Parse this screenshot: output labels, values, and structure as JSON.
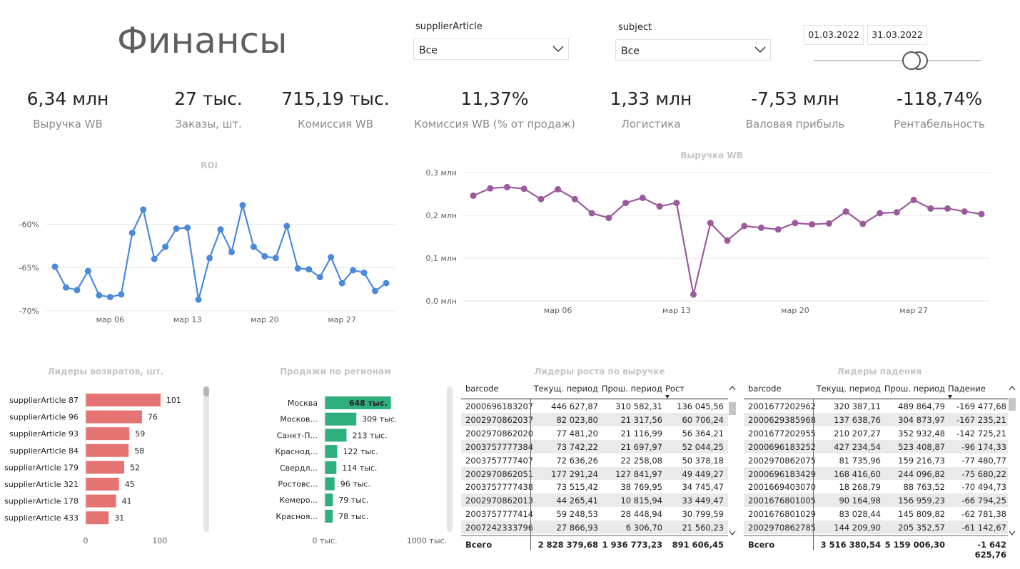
{
  "page_title": "Финансы",
  "filters": {
    "supplier_article": {
      "label": "supplierArticle",
      "value": "Все"
    },
    "subject": {
      "label": "subject",
      "value": "Все"
    },
    "date_from": "01.03.2022",
    "date_to": "31.03.2022"
  },
  "kpis": [
    {
      "value": "6,34 млн",
      "label": "Выручка WB"
    },
    {
      "value": "27 тыс.",
      "label": "Заказы, шт."
    },
    {
      "value": "715,19 тыс.",
      "label": "Комиссия WB"
    },
    {
      "value": "11,37%",
      "label": "Комиссия WB (% от продаж)"
    },
    {
      "value": "1,33 млн",
      "label": "Логистика"
    },
    {
      "value": "-7,53 млн",
      "label": "Валовая прибыль"
    },
    {
      "value": "-118,74%",
      "label": "Рентабельность"
    }
  ],
  "chart_data": [
    {
      "type": "line",
      "title": "ROI",
      "color": "#4a89dc",
      "x": [
        "2022-03-01",
        "2022-03-02",
        "2022-03-03",
        "2022-03-04",
        "2022-03-05",
        "2022-03-06",
        "2022-03-07",
        "2022-03-08",
        "2022-03-09",
        "2022-03-10",
        "2022-03-11",
        "2022-03-12",
        "2022-03-13",
        "2022-03-14",
        "2022-03-15",
        "2022-03-16",
        "2022-03-17",
        "2022-03-18",
        "2022-03-19",
        "2022-03-20",
        "2022-03-21",
        "2022-03-22",
        "2022-03-23",
        "2022-03-24",
        "2022-03-25",
        "2022-03-26",
        "2022-03-27",
        "2022-03-28",
        "2022-03-29",
        "2022-03-30",
        "2022-03-31"
      ],
      "values": [
        -64.9,
        -67.3,
        -67.6,
        -65.4,
        -68.2,
        -68.4,
        -68.1,
        -61.0,
        -58.3,
        -64.0,
        -62.6,
        -60.5,
        -60.4,
        -68.7,
        -63.9,
        -60.6,
        -63.2,
        -57.8,
        -62.6,
        -63.7,
        -63.9,
        -60.2,
        -65.1,
        -65.2,
        -66.1,
        -63.8,
        -66.8,
        -65.3,
        -65.6,
        -67.7,
        -66.8
      ],
      "xticks": [
        "мар 06",
        "мар 13",
        "мар 20",
        "мар 27"
      ],
      "yticks": [
        "-60%",
        "-65%",
        "-70%"
      ],
      "ylim": [
        -70,
        -56.5
      ]
    },
    {
      "type": "line",
      "title": "Выручка WB",
      "color": "#9b5a9b",
      "x": [
        "2022-03-01",
        "2022-03-02",
        "2022-03-03",
        "2022-03-04",
        "2022-03-05",
        "2022-03-06",
        "2022-03-07",
        "2022-03-08",
        "2022-03-09",
        "2022-03-10",
        "2022-03-11",
        "2022-03-12",
        "2022-03-13",
        "2022-03-14",
        "2022-03-15",
        "2022-03-16",
        "2022-03-17",
        "2022-03-18",
        "2022-03-19",
        "2022-03-20",
        "2022-03-21",
        "2022-03-22",
        "2022-03-23",
        "2022-03-24",
        "2022-03-25",
        "2022-03-26",
        "2022-03-27",
        "2022-03-28",
        "2022-03-29",
        "2022-03-30",
        "2022-03-31"
      ],
      "values": [
        0.246,
        0.263,
        0.266,
        0.262,
        0.238,
        0.261,
        0.238,
        0.205,
        0.194,
        0.229,
        0.241,
        0.221,
        0.229,
        0.015,
        0.182,
        0.141,
        0.175,
        0.171,
        0.167,
        0.182,
        0.179,
        0.181,
        0.209,
        0.18,
        0.205,
        0.207,
        0.236,
        0.216,
        0.216,
        0.209,
        0.203
      ],
      "xticks": [
        "мар 06",
        "мар 13",
        "мар 20",
        "мар 27"
      ],
      "yticks": [
        "0,3 млн",
        "0,2 млн",
        "0,1 млн",
        "0,0 млн"
      ],
      "ylim": [
        0,
        0.3
      ]
    },
    {
      "type": "bar",
      "title": "Лидеры возвратов, шт.",
      "color": "#e57373",
      "categories": [
        "supplierArticle 87",
        "supplierArticle 96",
        "supplierArticle 93",
        "supplierArticle 84",
        "supplierArticle 179",
        "supplierArticle 321",
        "supplierArticle 178",
        "supplierArticle 433"
      ],
      "values": [
        101,
        76,
        59,
        58,
        52,
        45,
        41,
        31
      ],
      "xticks": [
        "0",
        "100"
      ],
      "xlim": [
        0,
        104
      ]
    },
    {
      "type": "bar",
      "title": "Продажи по регионам",
      "color": "#2fae7e",
      "categories": [
        "Москва",
        "Москов...",
        "Санкт-П...",
        "Краснод...",
        "Свердл...",
        "Ростовс...",
        "Кемеро...",
        "Красноя..."
      ],
      "values": [
        648,
        309,
        213,
        122,
        114,
        96,
        79,
        78
      ],
      "labels": [
        "648 тыс.",
        "309 тыс.",
        "213 тыс.",
        "122 тыс.",
        "114 тыс.",
        "96 тыс.",
        "79 тыс.",
        "78 тыс."
      ],
      "xticks": [
        "0 тыс.",
        "1000 тыс."
      ],
      "xlim": [
        0,
        1000
      ]
    }
  ],
  "growth_table": {
    "title": "Лидеры роста по выручке",
    "columns": [
      "barcode",
      "Текущ. период",
      "Прош. период",
      "Рост"
    ],
    "rows": [
      [
        "2000696183207",
        "446 627,87",
        "310 582,31",
        "136 045,56"
      ],
      [
        "2002970862037",
        "82 023,80",
        "21 317,56",
        "60 706,24"
      ],
      [
        "2002970862020",
        "77 481,20",
        "21 116,99",
        "56 364,21"
      ],
      [
        "2003757777384",
        "73 742,22",
        "21 697,97",
        "52 044,25"
      ],
      [
        "2003757777407",
        "72 636,26",
        "22 258,08",
        "50 378,18"
      ],
      [
        "2002970862051",
        "177 291,24",
        "127 841,97",
        "49 449,27"
      ],
      [
        "2003757777438",
        "73 515,42",
        "38 769,95",
        "34 745,47"
      ],
      [
        "2002970862013",
        "44 265,41",
        "10 815,94",
        "33 449,47"
      ],
      [
        "2003757777414",
        "59 248,53",
        "28 448,94",
        "30 799,59"
      ],
      [
        "2007242333796",
        "27 866,93",
        "6 306,70",
        "21 560,23"
      ]
    ],
    "total": [
      "Всего",
      "2 828 379,68",
      "1 936 773,23",
      "891 606,45"
    ]
  },
  "decline_table": {
    "title": "Лидеры падения",
    "columns": [
      "barcode",
      "Текущ. период",
      "Прош. период",
      "Падение"
    ],
    "rows": [
      [
        "2001677202962",
        "320 387,11",
        "489 864,79",
        "-169 477,68"
      ],
      [
        "2000629385968",
        "137 638,76",
        "304 873,97",
        "-167 235,21"
      ],
      [
        "2001677202955",
        "210 207,27",
        "352 932,48",
        "-142 725,21"
      ],
      [
        "2000696183252",
        "427 234,54",
        "523 408,87",
        "-96 174,33"
      ],
      [
        "2002970862075",
        "81 735,96",
        "159 216,73",
        "-77 480,77"
      ],
      [
        "2000696183429",
        "168 416,60",
        "244 096,82",
        "-75 680,22"
      ],
      [
        "2001669403070",
        "18 268,79",
        "88 763,52",
        "-70 494,73"
      ],
      [
        "2001676801005",
        "90 164,98",
        "156 959,23",
        "-66 794,25"
      ],
      [
        "2001676801029",
        "83 028,44",
        "145 809,82",
        "-62 781,38"
      ],
      [
        "2002970862785",
        "144 209,90",
        "205 352,57",
        "-61 142,67"
      ]
    ],
    "total": [
      "Всего",
      "3 516 380,54",
      "5 159 006,30",
      "-1 642 625,76"
    ]
  }
}
